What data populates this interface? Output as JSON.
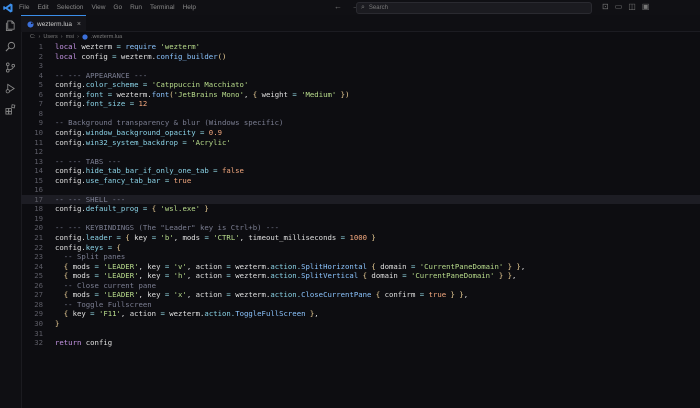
{
  "menu": [
    "File",
    "Edit",
    "Selection",
    "View",
    "Go",
    "Run",
    "Terminal",
    "Help"
  ],
  "search_placeholder": "Search",
  "tab": {
    "label": "wezterm.lua"
  },
  "breadcrumb": [
    "C:",
    "Users",
    "msi",
    ".wezterm.lua"
  ],
  "lines": [
    {
      "n": "1",
      "t": [
        [
          "k",
          "local "
        ],
        [
          "v",
          "wezterm "
        ],
        [
          "o",
          "= "
        ],
        [
          "f",
          "require "
        ],
        [
          "s",
          "'wezterm'"
        ]
      ]
    },
    {
      "n": "2",
      "t": [
        [
          "k",
          "local "
        ],
        [
          "v",
          "config "
        ],
        [
          "o",
          "= "
        ],
        [
          "v",
          "wezterm."
        ],
        [
          "f",
          "config_builder"
        ],
        [
          "b",
          "()"
        ]
      ]
    },
    {
      "n": "3",
      "t": []
    },
    {
      "n": "4",
      "t": [
        [
          "c",
          "-- --- APPEARANCE ---"
        ]
      ]
    },
    {
      "n": "5",
      "t": [
        [
          "v",
          "config."
        ],
        [
          "p",
          "color_scheme "
        ],
        [
          "o",
          "= "
        ],
        [
          "s",
          "'Catppuccin Macchiato'"
        ]
      ]
    },
    {
      "n": "6",
      "t": [
        [
          "v",
          "config."
        ],
        [
          "p",
          "font "
        ],
        [
          "o",
          "= "
        ],
        [
          "v",
          "wezterm."
        ],
        [
          "f",
          "font"
        ],
        [
          "b",
          "("
        ],
        [
          "s",
          "'JetBrains Mono'"
        ],
        [
          "v",
          ", "
        ],
        [
          "b",
          "{ "
        ],
        [
          "v",
          "weight "
        ],
        [
          "o",
          "= "
        ],
        [
          "s",
          "'Medium' "
        ],
        [
          "b",
          "})"
        ]
      ]
    },
    {
      "n": "7",
      "t": [
        [
          "v",
          "config."
        ],
        [
          "p",
          "font_size "
        ],
        [
          "o",
          "= "
        ],
        [
          "n",
          "12"
        ]
      ]
    },
    {
      "n": "8",
      "t": []
    },
    {
      "n": "9",
      "t": [
        [
          "c",
          "-- Background transparency & blur (Windows specific)"
        ]
      ]
    },
    {
      "n": "10",
      "t": [
        [
          "v",
          "config."
        ],
        [
          "p",
          "window_background_opacity "
        ],
        [
          "o",
          "= "
        ],
        [
          "n",
          "0.9"
        ]
      ]
    },
    {
      "n": "11",
      "t": [
        [
          "v",
          "config."
        ],
        [
          "p",
          "win32_system_backdrop "
        ],
        [
          "o",
          "= "
        ],
        [
          "s",
          "'Acrylic'"
        ]
      ]
    },
    {
      "n": "12",
      "t": []
    },
    {
      "n": "13",
      "t": [
        [
          "c",
          "-- --- TABS ---"
        ]
      ]
    },
    {
      "n": "14",
      "t": [
        [
          "v",
          "config."
        ],
        [
          "p",
          "hide_tab_bar_if_only_one_tab "
        ],
        [
          "o",
          "= "
        ],
        [
          "n",
          "false"
        ]
      ]
    },
    {
      "n": "15",
      "t": [
        [
          "v",
          "config."
        ],
        [
          "p",
          "use_fancy_tab_bar "
        ],
        [
          "o",
          "= "
        ],
        [
          "n",
          "true"
        ]
      ]
    },
    {
      "n": "16",
      "t": []
    },
    {
      "n": "17",
      "t": [
        [
          "c",
          "-- --- SHELL ---"
        ]
      ],
      "hl": true
    },
    {
      "n": "18",
      "t": [
        [
          "v",
          "config."
        ],
        [
          "p",
          "default_prog "
        ],
        [
          "o",
          "= "
        ],
        [
          "b",
          "{ "
        ],
        [
          "s",
          "'wsl.exe' "
        ],
        [
          "b",
          "}"
        ]
      ]
    },
    {
      "n": "19",
      "t": []
    },
    {
      "n": "20",
      "t": [
        [
          "c",
          "-- --- KEYBINDINGS (The \"Leader\" key is Ctrl+b) ---"
        ]
      ]
    },
    {
      "n": "21",
      "t": [
        [
          "v",
          "config."
        ],
        [
          "p",
          "leader "
        ],
        [
          "o",
          "= "
        ],
        [
          "b",
          "{ "
        ],
        [
          "v",
          "key "
        ],
        [
          "o",
          "= "
        ],
        [
          "s",
          "'b'"
        ],
        [
          "v",
          ", mods "
        ],
        [
          "o",
          "= "
        ],
        [
          "s",
          "'CTRL'"
        ],
        [
          "v",
          ", timeout_milliseconds "
        ],
        [
          "o",
          "= "
        ],
        [
          "n",
          "1000 "
        ],
        [
          "b",
          "}"
        ]
      ]
    },
    {
      "n": "22",
      "t": [
        [
          "v",
          "config."
        ],
        [
          "p",
          "keys "
        ],
        [
          "o",
          "= "
        ],
        [
          "b",
          "{"
        ]
      ]
    },
    {
      "n": "23",
      "t": [
        [
          "c",
          "  -- Split panes"
        ]
      ]
    },
    {
      "n": "24",
      "t": [
        [
          "b",
          "  { "
        ],
        [
          "v",
          "mods "
        ],
        [
          "o",
          "= "
        ],
        [
          "s",
          "'LEADER'"
        ],
        [
          "v",
          ", key "
        ],
        [
          "o",
          "= "
        ],
        [
          "s",
          "'v'"
        ],
        [
          "v",
          ", action "
        ],
        [
          "o",
          "= "
        ],
        [
          "v",
          "wezterm."
        ],
        [
          "p",
          "action."
        ],
        [
          "f",
          "SplitHorizontal "
        ],
        [
          "b",
          "{ "
        ],
        [
          "v",
          "domain "
        ],
        [
          "o",
          "= "
        ],
        [
          "s",
          "'CurrentPaneDomain' "
        ],
        [
          "b",
          "} }"
        ],
        [
          "v",
          ","
        ]
      ]
    },
    {
      "n": "25",
      "t": [
        [
          "b",
          "  { "
        ],
        [
          "v",
          "mods "
        ],
        [
          "o",
          "= "
        ],
        [
          "s",
          "'LEADER'"
        ],
        [
          "v",
          ", key "
        ],
        [
          "o",
          "= "
        ],
        [
          "s",
          "'h'"
        ],
        [
          "v",
          ", action "
        ],
        [
          "o",
          "= "
        ],
        [
          "v",
          "wezterm."
        ],
        [
          "p",
          "action."
        ],
        [
          "f",
          "SplitVertical "
        ],
        [
          "b",
          "{ "
        ],
        [
          "v",
          "domain "
        ],
        [
          "o",
          "= "
        ],
        [
          "s",
          "'CurrentPaneDomain' "
        ],
        [
          "b",
          "} }"
        ],
        [
          "v",
          ","
        ]
      ]
    },
    {
      "n": "26",
      "t": [
        [
          "c",
          "  -- Close current pane"
        ]
      ]
    },
    {
      "n": "27",
      "t": [
        [
          "b",
          "  { "
        ],
        [
          "v",
          "mods "
        ],
        [
          "o",
          "= "
        ],
        [
          "s",
          "'LEADER'"
        ],
        [
          "v",
          ", key "
        ],
        [
          "o",
          "= "
        ],
        [
          "s",
          "'x'"
        ],
        [
          "v",
          ", action "
        ],
        [
          "o",
          "= "
        ],
        [
          "v",
          "wezterm."
        ],
        [
          "p",
          "action."
        ],
        [
          "f",
          "CloseCurrentPane "
        ],
        [
          "b",
          "{ "
        ],
        [
          "v",
          "confirm "
        ],
        [
          "o",
          "= "
        ],
        [
          "n",
          "true "
        ],
        [
          "b",
          "} }"
        ],
        [
          "v",
          ","
        ]
      ]
    },
    {
      "n": "28",
      "t": [
        [
          "c",
          "  -- Toggle Fullscreen"
        ]
      ]
    },
    {
      "n": "29",
      "t": [
        [
          "b",
          "  { "
        ],
        [
          "v",
          "key "
        ],
        [
          "o",
          "= "
        ],
        [
          "s",
          "'F11'"
        ],
        [
          "v",
          ", action "
        ],
        [
          "o",
          "= "
        ],
        [
          "v",
          "wezterm."
        ],
        [
          "p",
          "action."
        ],
        [
          "f",
          "ToggleFullScreen "
        ],
        [
          "b",
          "}"
        ],
        [
          "v",
          ","
        ]
      ]
    },
    {
      "n": "30",
      "t": [
        [
          "b",
          "}"
        ]
      ]
    },
    {
      "n": "31",
      "t": []
    },
    {
      "n": "32",
      "t": [
        [
          "k",
          "return "
        ],
        [
          "v",
          "config"
        ]
      ]
    }
  ]
}
